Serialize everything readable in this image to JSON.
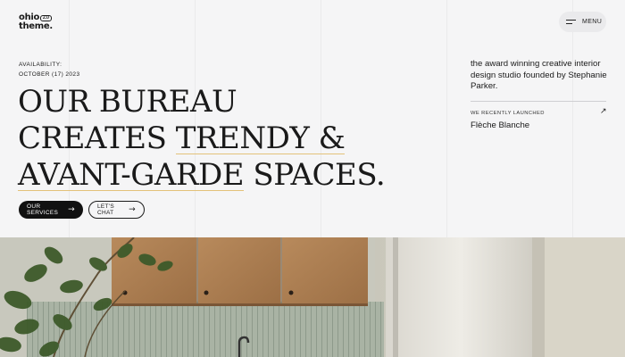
{
  "logo": {
    "line1": "ohio",
    "line2": "theme.",
    "badge": "2.0"
  },
  "menu": {
    "label": "MENU",
    "icon": "hamburger-icon"
  },
  "availability": {
    "label": "AVAILABILITY:",
    "date": "OCTOBER (17) 2023"
  },
  "headline": {
    "line1": "OUR BUREAU",
    "line2_a": "CREATES ",
    "line2_b": "TRENDY &",
    "line3_a": "AVANT-GARDE",
    "line3_b": " SPACES.",
    "underline_color": "#e3c27a"
  },
  "buttons": {
    "services": "OUR SERVICES",
    "chat": "LET'S CHAT",
    "arrow_icon": "arrow-right-icon"
  },
  "tagline": "the award winning creative interior design studio founded by Stephanie Parker.",
  "launched": {
    "label": "WE RECENTLY LAUNCHED",
    "name": "Flèche Blanche",
    "icon": "arrow-up-right-icon"
  },
  "hero": {
    "image": "kitchen-interior-photo"
  },
  "colors": {
    "background": "#f5f5f6",
    "text": "#1a1a1a",
    "accent": "#e3c27a",
    "dark_button": "#111111"
  }
}
